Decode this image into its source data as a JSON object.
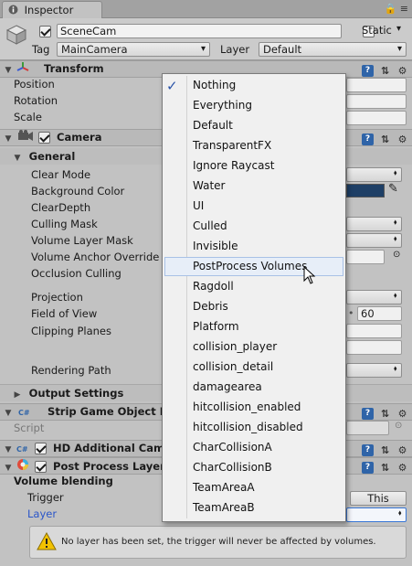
{
  "tab": {
    "title": "Inspector"
  },
  "header": {
    "object_name": "SceneCam",
    "static_label": "Static",
    "tag_label": "Tag",
    "tag_value": "MainCamera",
    "layer_label": "Layer",
    "layer_value": "Default"
  },
  "transform": {
    "title": "Transform",
    "position_label": "Position",
    "rotation_label": "Rotation",
    "scale_label": "Scale"
  },
  "camera": {
    "title": "Camera",
    "general_label": "General",
    "props": [
      "Clear Mode",
      "Background Color",
      "ClearDepth",
      "Culling Mask",
      "Volume Layer Mask",
      "Volume Anchor Override",
      "Occlusion Culling",
      "Projection",
      "Field of View",
      "Clipping Planes",
      "Rendering Path"
    ],
    "fov_value": "60",
    "background_color": "#1e3f66",
    "output_settings_label": "Output Settings"
  },
  "strip": {
    "title": "Strip Game Object F",
    "script_label": "Script"
  },
  "hd_camera": {
    "title": "HD Additional Came"
  },
  "ppl": {
    "title": "Post Process Layer",
    "volume_blending_label": "Volume blending",
    "trigger_label": "Trigger",
    "trigger_button": "This",
    "layer_label": "Layer"
  },
  "warning": {
    "text": "No layer has been set, the trigger will never be affected by volumes."
  },
  "menu": {
    "items": [
      "Nothing",
      "Everything",
      "Default",
      "TransparentFX",
      "Ignore Raycast",
      "Water",
      "UI",
      "Culled",
      "Invisible",
      "PostProcess Volumes",
      "Ragdoll",
      "Debris",
      "Platform",
      "collision_player",
      "collision_detail",
      "damagearea",
      "hitcollision_enabled",
      "hitcollision_disabled",
      "CharCollisionA",
      "CharCollisionB",
      "TeamAreaA",
      "TeamAreaB"
    ],
    "checked_item": "Nothing",
    "highlighted_item": "PostProcess Volumes"
  },
  "colors": {
    "accent_blue": "#2f64a8",
    "layer_label_blue": "#2b56c9",
    "menu_highlight": "#e7eef8"
  }
}
